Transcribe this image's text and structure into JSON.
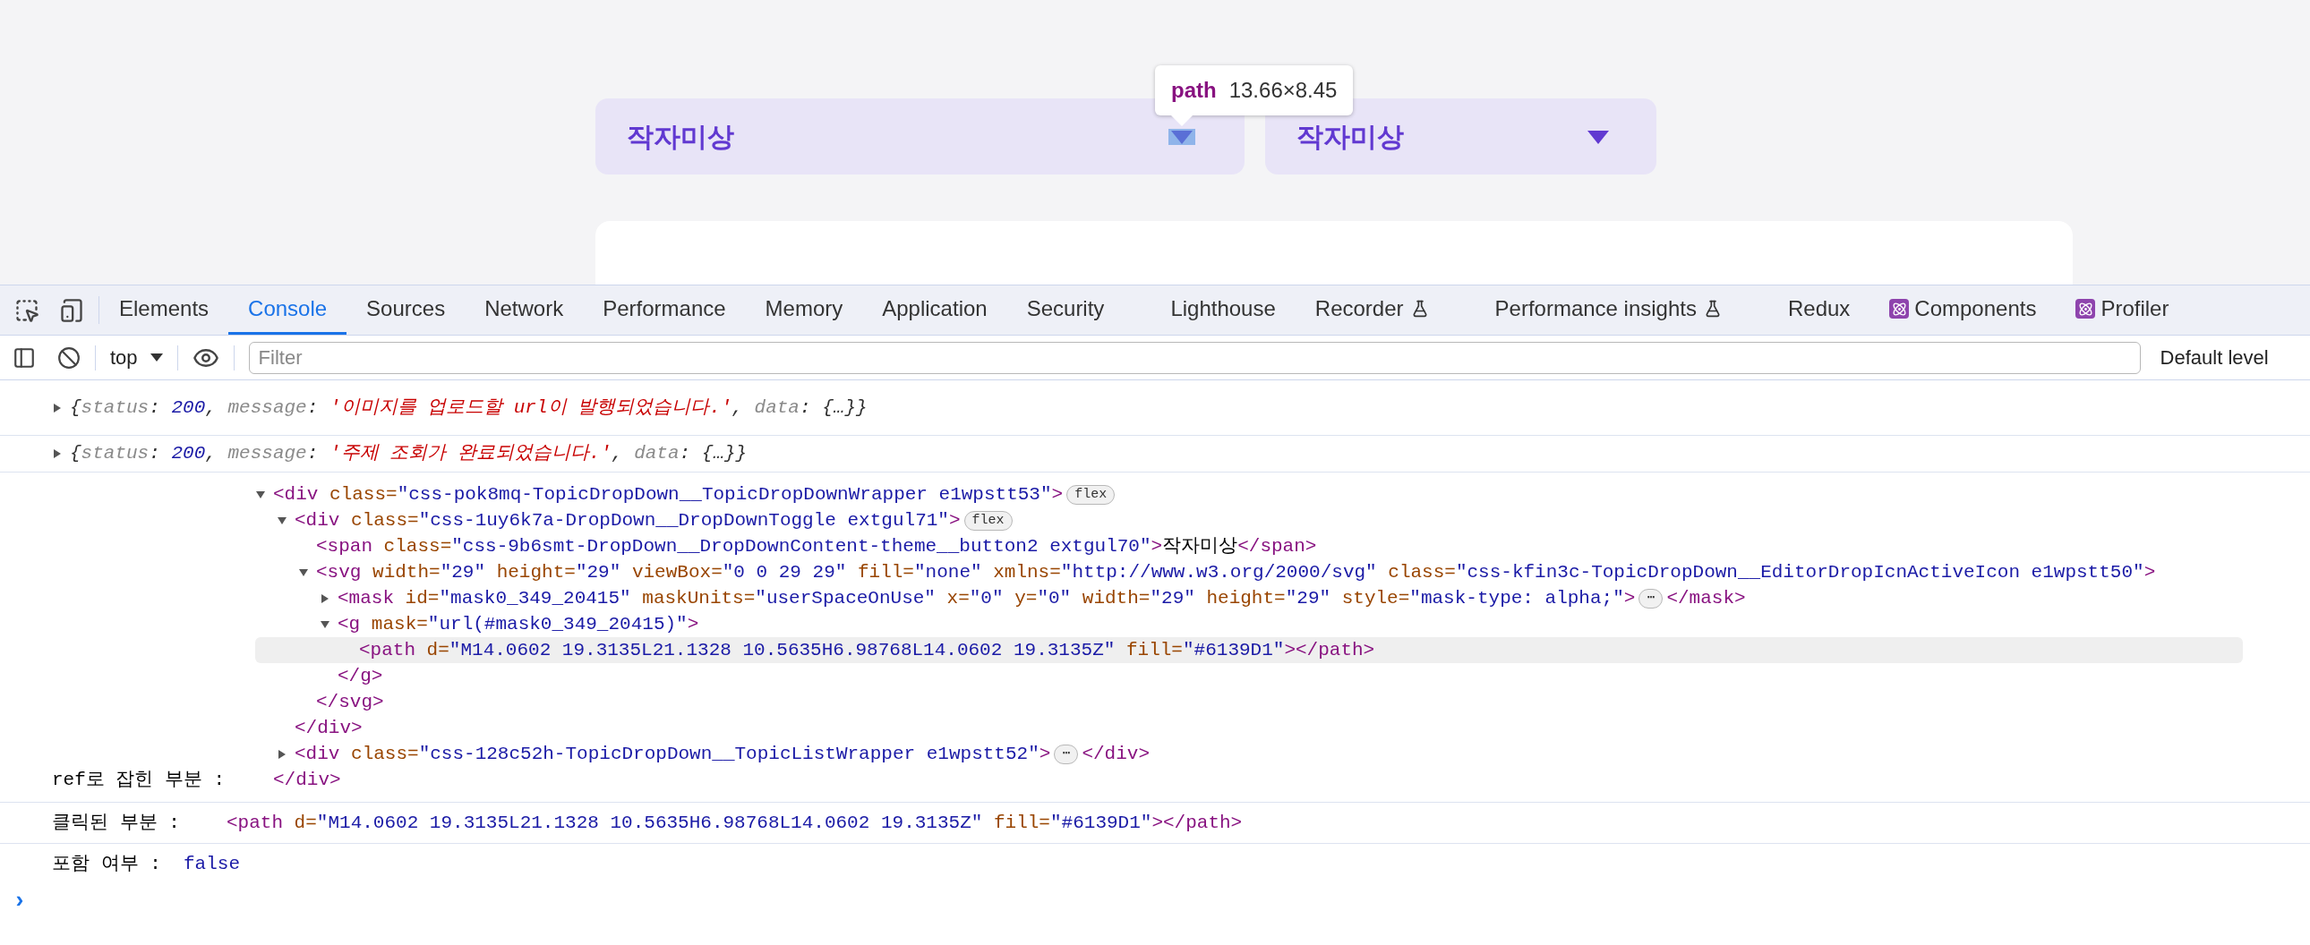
{
  "page": {
    "dropdowns": [
      {
        "label": "작자미상",
        "inspected": true
      },
      {
        "label": "작자미상",
        "inspected": false
      }
    ],
    "tooltip": {
      "tag": "path",
      "size": "13.66×8.45"
    }
  },
  "devtools": {
    "tabs": [
      {
        "label": "Elements",
        "selected": false,
        "kind": "plain"
      },
      {
        "label": "Console",
        "selected": true,
        "kind": "plain"
      },
      {
        "label": "Sources",
        "selected": false,
        "kind": "plain"
      },
      {
        "label": "Network",
        "selected": false,
        "kind": "plain"
      },
      {
        "label": "Performance",
        "selected": false,
        "kind": "plain"
      },
      {
        "label": "Memory",
        "selected": false,
        "kind": "plain"
      },
      {
        "label": "Application",
        "selected": false,
        "kind": "plain"
      },
      {
        "label": "Security",
        "selected": false,
        "kind": "plain"
      },
      {
        "label": "Lighthouse",
        "selected": false,
        "kind": "plain"
      },
      {
        "label": "Recorder",
        "selected": false,
        "kind": "flask"
      },
      {
        "label": "Performance insights",
        "selected": false,
        "kind": "flask"
      },
      {
        "label": "Redux",
        "selected": false,
        "kind": "plain"
      },
      {
        "label": "Components",
        "selected": false,
        "kind": "react"
      },
      {
        "label": "Profiler",
        "selected": false,
        "kind": "react"
      }
    ],
    "toolbar": {
      "context": "top",
      "filter_placeholder": "Filter",
      "levels": "Default level"
    },
    "console": {
      "logs": [
        {
          "expanded": false,
          "segments": [
            {
              "kind": "punct",
              "text": "{"
            },
            {
              "kind": "key",
              "text": "status"
            },
            {
              "kind": "punct",
              "text": ": "
            },
            {
              "kind": "number",
              "text": "200"
            },
            {
              "kind": "punct",
              "text": ", "
            },
            {
              "kind": "key",
              "text": "message"
            },
            {
              "kind": "punct",
              "text": ": "
            },
            {
              "kind": "string",
              "text": "'이미지를 업로드할 url이 발행되었습니다.'"
            },
            {
              "kind": "punct",
              "text": ", "
            },
            {
              "kind": "key",
              "text": "data"
            },
            {
              "kind": "punct",
              "text": ": {…}}"
            }
          ]
        },
        {
          "expanded": false,
          "segments": [
            {
              "kind": "punct",
              "text": "{"
            },
            {
              "kind": "key",
              "text": "status"
            },
            {
              "kind": "punct",
              "text": ": "
            },
            {
              "kind": "number",
              "text": "200"
            },
            {
              "kind": "punct",
              "text": ", "
            },
            {
              "kind": "key",
              "text": "message"
            },
            {
              "kind": "punct",
              "text": ": "
            },
            {
              "kind": "string",
              "text": "'주제 조회가 완료되었습니다.'"
            },
            {
              "kind": "punct",
              "text": ", "
            },
            {
              "kind": "key",
              "text": "data"
            },
            {
              "kind": "punct",
              "text": ": {…}}"
            }
          ]
        }
      ],
      "ref_label": "ref로 잡힌 부분 :",
      "tree": {
        "expanded": true,
        "line": [
          {
            "kind": "tag",
            "text": "<div"
          },
          {
            "kind": "attr",
            "text": " class="
          },
          {
            "kind": "value",
            "text": "\"css-pok8mq-TopicDropDown__TopicDropDownWrapper e1wpstt53\""
          },
          {
            "kind": "tag",
            "text": ">"
          },
          {
            "kind": "pill",
            "text": "flex"
          }
        ],
        "children": [
          {
            "expanded": true,
            "line": [
              {
                "kind": "tag",
                "text": "<div"
              },
              {
                "kind": "attr",
                "text": " class="
              },
              {
                "kind": "value",
                "text": "\"css-1uy6k7a-DropDown__DropDownToggle extgul71\""
              },
              {
                "kind": "tag",
                "text": ">"
              },
              {
                "kind": "pill",
                "text": "flex"
              }
            ],
            "children": [
              {
                "line": [
                  {
                    "kind": "tag",
                    "text": "<span"
                  },
                  {
                    "kind": "attr",
                    "text": " class="
                  },
                  {
                    "kind": "value",
                    "text": "\"css-9b6smt-DropDown__DropDownContent-theme__button2 extgul70\""
                  },
                  {
                    "kind": "tag",
                    "text": ">"
                  },
                  {
                    "kind": "text",
                    "text": "작자미상"
                  },
                  {
                    "kind": "tag",
                    "text": "</span>"
                  }
                ]
              },
              {
                "expanded": true,
                "line": [
                  {
                    "kind": "tag",
                    "text": "<svg"
                  },
                  {
                    "kind": "attr",
                    "text": " width="
                  },
                  {
                    "kind": "value",
                    "text": "\"29\""
                  },
                  {
                    "kind": "attr",
                    "text": " height="
                  },
                  {
                    "kind": "value",
                    "text": "\"29\""
                  },
                  {
                    "kind": "attr",
                    "text": " viewBox="
                  },
                  {
                    "kind": "value",
                    "text": "\"0 0 29 29\""
                  },
                  {
                    "kind": "attr",
                    "text": " fill="
                  },
                  {
                    "kind": "value",
                    "text": "\"none\""
                  },
                  {
                    "kind": "attr",
                    "text": " xmlns="
                  },
                  {
                    "kind": "value",
                    "text": "\"http://www.w3.org/2000/svg\""
                  },
                  {
                    "kind": "attr",
                    "text": " class="
                  },
                  {
                    "kind": "value",
                    "text": "\"css-kfin3c-TopicDropDown__EditorDropIcnActiveIcon e1wpstt50\""
                  },
                  {
                    "kind": "tag",
                    "text": ">"
                  }
                ],
                "children": [
                  {
                    "expanded": false,
                    "line": [
                      {
                        "kind": "tag",
                        "text": "<mask"
                      },
                      {
                        "kind": "attr",
                        "text": " id="
                      },
                      {
                        "kind": "value",
                        "text": "\"mask0_349_20415\""
                      },
                      {
                        "kind": "attr",
                        "text": " maskUnits="
                      },
                      {
                        "kind": "value",
                        "text": "\"userSpaceOnUse\""
                      },
                      {
                        "kind": "attr",
                        "text": " x="
                      },
                      {
                        "kind": "value",
                        "text": "\"0\""
                      },
                      {
                        "kind": "attr",
                        "text": " y="
                      },
                      {
                        "kind": "value",
                        "text": "\"0\""
                      },
                      {
                        "kind": "attr",
                        "text": " width="
                      },
                      {
                        "kind": "value",
                        "text": "\"29\""
                      },
                      {
                        "kind": "attr",
                        "text": " height="
                      },
                      {
                        "kind": "value",
                        "text": "\"29\""
                      },
                      {
                        "kind": "attr",
                        "text": " style="
                      },
                      {
                        "kind": "value",
                        "text": "\"mask-type: alpha;\""
                      },
                      {
                        "kind": "tag",
                        "text": ">"
                      },
                      {
                        "kind": "pill",
                        "text": "⋯"
                      },
                      {
                        "kind": "tag",
                        "text": "</mask>"
                      }
                    ]
                  },
                  {
                    "expanded": true,
                    "line": [
                      {
                        "kind": "tag",
                        "text": "<g"
                      },
                      {
                        "kind": "attr",
                        "text": " mask="
                      },
                      {
                        "kind": "value",
                        "text": "\"url(#mask0_349_20415)\""
                      },
                      {
                        "kind": "tag",
                        "text": ">"
                      }
                    ],
                    "children": [
                      {
                        "highlighted": true,
                        "line": [
                          {
                            "kind": "tag",
                            "text": "<path"
                          },
                          {
                            "kind": "attr",
                            "text": " d="
                          },
                          {
                            "kind": "value",
                            "text": "\"M14.0602 19.3135L21.1328 10.5635H6.98768L14.0602 19.3135Z\""
                          },
                          {
                            "kind": "attr",
                            "text": " fill="
                          },
                          {
                            "kind": "value",
                            "text": "\"#6139D1\""
                          },
                          {
                            "kind": "tag",
                            "text": "></path>"
                          }
                        ]
                      }
                    ],
                    "closing": [
                      {
                        "kind": "tag",
                        "text": "</g>"
                      }
                    ]
                  }
                ],
                "closing": [
                  {
                    "kind": "tag",
                    "text": "</svg>"
                  }
                ]
              }
            ],
            "closing": [
              {
                "kind": "tag",
                "text": "</div>"
              }
            ]
          },
          {
            "expanded": false,
            "line": [
              {
                "kind": "tag",
                "text": "<div"
              },
              {
                "kind": "attr",
                "text": " class="
              },
              {
                "kind": "value",
                "text": "\"css-128c52h-TopicDropDown__TopicListWrapper e1wpstt52\""
              },
              {
                "kind": "tag",
                "text": ">"
              },
              {
                "kind": "pill",
                "text": "⋯"
              },
              {
                "kind": "tag",
                "text": "</div>"
              }
            ]
          }
        ],
        "closing": [
          {
            "kind": "tag",
            "text": "</div>"
          }
        ]
      },
      "clicked": {
        "label": "클릭된 부분 :",
        "segments": [
          {
            "kind": "tag",
            "text": "<path"
          },
          {
            "kind": "attr",
            "text": " d="
          },
          {
            "kind": "value",
            "text": "\"M14.0602 19.3135L21.1328 10.5635H6.98768L14.0602 19.3135Z\""
          },
          {
            "kind": "attr",
            "text": " fill="
          },
          {
            "kind": "value",
            "text": "\"#6139D1\""
          },
          {
            "kind": "tag",
            "text": "></path>"
          }
        ]
      },
      "contains": {
        "label": "포함 여부 :",
        "value": "false"
      },
      "prompt": "›"
    }
  }
}
